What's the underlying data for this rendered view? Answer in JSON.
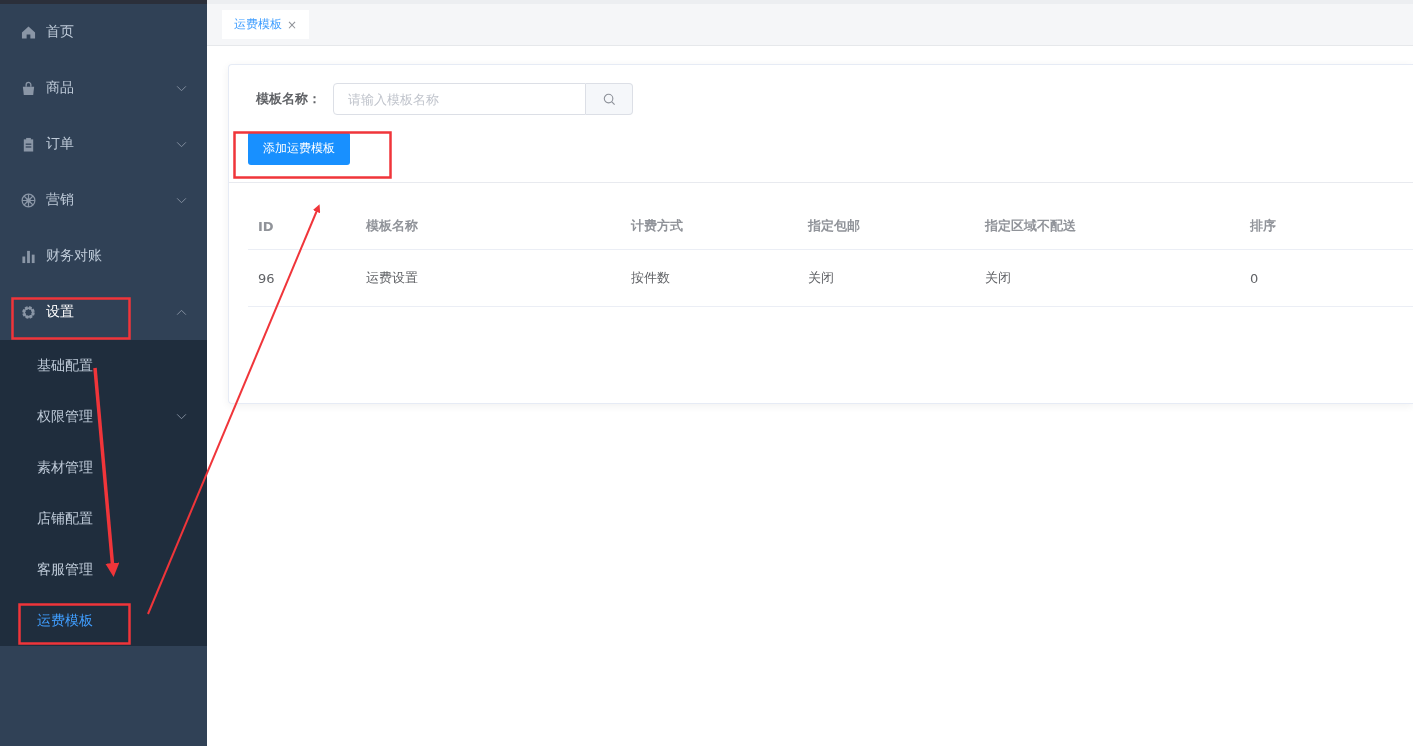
{
  "sidebar": {
    "items": [
      {
        "label": "首页",
        "kind": "link",
        "selected": false
      },
      {
        "label": "商品",
        "kind": "submenu",
        "expanded": false,
        "selected": false
      },
      {
        "label": "订单",
        "kind": "submenu",
        "expanded": false,
        "selected": false
      },
      {
        "label": "营销",
        "kind": "submenu",
        "expanded": false,
        "selected": false
      },
      {
        "label": "财务对账",
        "kind": "link",
        "selected": false
      },
      {
        "label": "设置",
        "kind": "submenu",
        "expanded": true,
        "selected": false,
        "children": [
          {
            "label": "基础配置",
            "kind": "link",
            "selected": false
          },
          {
            "label": "权限管理",
            "kind": "submenu",
            "selected": false
          },
          {
            "label": "素材管理",
            "kind": "link",
            "selected": false
          },
          {
            "label": "店铺配置",
            "kind": "link",
            "selected": false
          },
          {
            "label": "客服管理",
            "kind": "link",
            "selected": false
          },
          {
            "label": "运费模板",
            "kind": "link",
            "selected": true
          }
        ]
      }
    ]
  },
  "tabs": [
    {
      "label": "运费模板",
      "selected": true,
      "close": "×"
    }
  ],
  "search": {
    "label": "模板名称：",
    "placeholder": "请输入模板名称"
  },
  "add_button": "添加运费模板",
  "table": {
    "columns": [
      "ID",
      "模板名称",
      "计费方式",
      "指定包邮",
      "指定区域不配送",
      "排序"
    ],
    "rows": [
      [
        "96",
        "运费设置",
        "按件数",
        "关闭",
        "关闭",
        "0"
      ]
    ]
  }
}
